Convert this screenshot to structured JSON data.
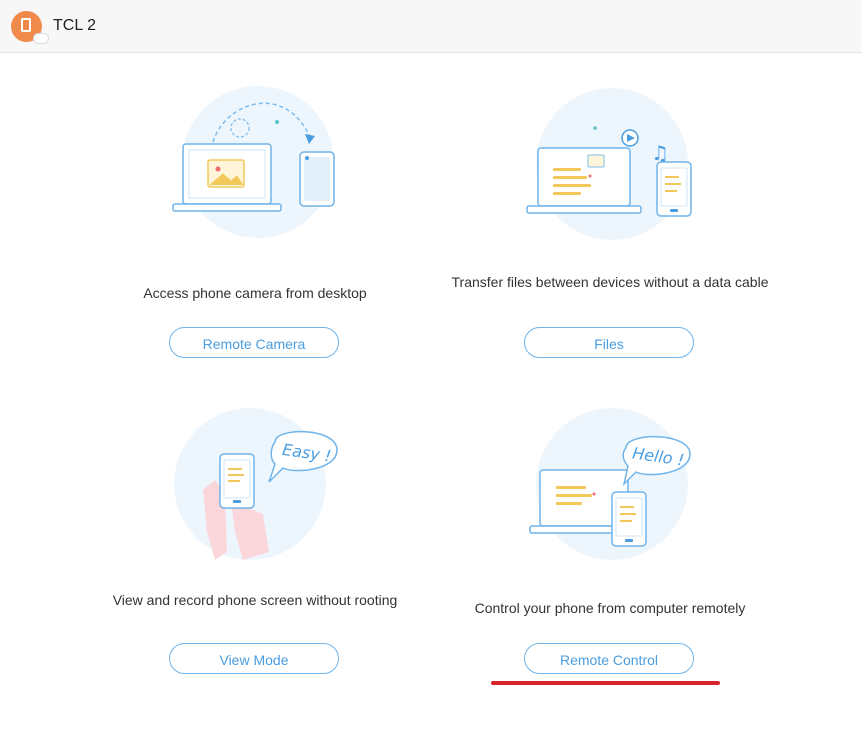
{
  "header": {
    "device_name": "TCL 2"
  },
  "features": [
    {
      "description": "Access phone camera from desktop",
      "button_label": "Remote Camera"
    },
    {
      "description": "Transfer files between devices without a data cable",
      "button_label": "Files"
    },
    {
      "description": "View and record phone screen without rooting",
      "button_label": "View Mode"
    },
    {
      "description": "Control your phone from computer remotely",
      "button_label": "Remote Control"
    }
  ],
  "illustration_text": {
    "easy": "Easy !",
    "hello": "Hello !"
  },
  "colors": {
    "accent": "#4a9de0",
    "button_border": "#6fb4ea",
    "highlight_underline": "#d9232d",
    "device_icon": "#f08a4b"
  },
  "icons": [
    "phone-device-icon",
    "camera-illustration",
    "files-illustration",
    "view-mode-illustration",
    "remote-control-illustration"
  ]
}
